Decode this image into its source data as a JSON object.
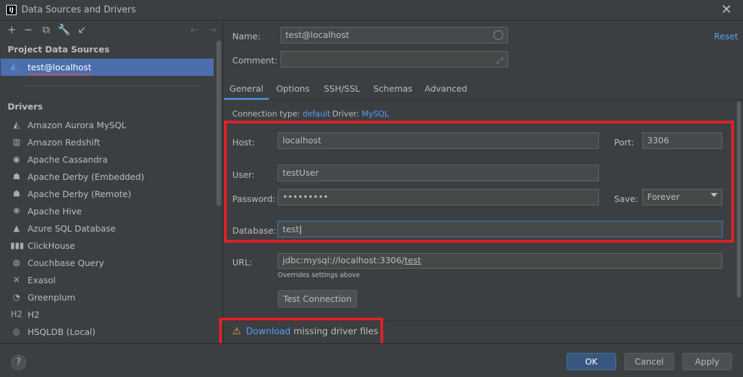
{
  "window": {
    "title": "Data Sources and Drivers",
    "logo": "IJ"
  },
  "left": {
    "project_title": "Project Data Sources",
    "selected_source": "test@localhost",
    "drivers_title": "Drivers",
    "drivers": [
      {
        "label": "Amazon Aurora MySQL",
        "icon": "dolphin-icon",
        "glyph": "◭"
      },
      {
        "label": "Amazon Redshift",
        "icon": "redshift-icon",
        "glyph": "▥"
      },
      {
        "label": "Apache Cassandra",
        "icon": "cassandra-icon",
        "glyph": "◉"
      },
      {
        "label": "Apache Derby (Embedded)",
        "icon": "derby-hat-icon",
        "glyph": "☗"
      },
      {
        "label": "Apache Derby (Remote)",
        "icon": "derby-hat-icon",
        "glyph": "☗"
      },
      {
        "label": "Apache Hive",
        "icon": "hive-icon",
        "glyph": "❋"
      },
      {
        "label": "Azure SQL Database",
        "icon": "azure-icon",
        "glyph": "▲"
      },
      {
        "label": "ClickHouse",
        "icon": "clickhouse-icon",
        "glyph": "▮▮▮"
      },
      {
        "label": "Couchbase Query",
        "icon": "couchbase-icon",
        "glyph": "◍"
      },
      {
        "label": "Exasol",
        "icon": "exasol-icon",
        "glyph": "✕"
      },
      {
        "label": "Greenplum",
        "icon": "greenplum-icon",
        "glyph": "◔"
      },
      {
        "label": "H2",
        "icon": "h2-icon",
        "glyph": "H2"
      },
      {
        "label": "HSQLDB (Local)",
        "icon": "hsqldb-icon",
        "glyph": "◎"
      }
    ]
  },
  "form": {
    "name_label": "Name:",
    "name_value": "test@localhost",
    "comment_label": "Comment:",
    "comment_value": "",
    "reset": "Reset",
    "tabs": [
      "General",
      "Options",
      "SSH/SSL",
      "Schemas",
      "Advanced"
    ],
    "active_tab": "General",
    "connection_type_label": "Connection type:",
    "connection_type_value": "default",
    "driver_label": "Driver:",
    "driver_value": "MySQL",
    "host_label": "Host:",
    "host_value": "localhost",
    "port_label": "Port:",
    "port_value": "3306",
    "user_label": "User:",
    "user_value": "testUser",
    "password_label": "Password:",
    "password_value": "•••••••••",
    "save_label": "Save:",
    "save_value": "Forever",
    "database_label": "Database:",
    "database_value": "test",
    "url_label": "URL:",
    "url_prefix": "jdbc:mysql://localhost:3306/",
    "url_db": "test",
    "url_hint": "Overrides settings above",
    "test_connection": "Test Connection",
    "warning_link": "Download",
    "warning_text": " missing driver files"
  },
  "buttons": {
    "help": "?",
    "ok": "OK",
    "cancel": "Cancel",
    "apply": "Apply"
  },
  "colors": {
    "highlight_box": "#e0202a",
    "link": "#589df6",
    "selection": "#4b6eaf",
    "ok_button": "#365880"
  }
}
